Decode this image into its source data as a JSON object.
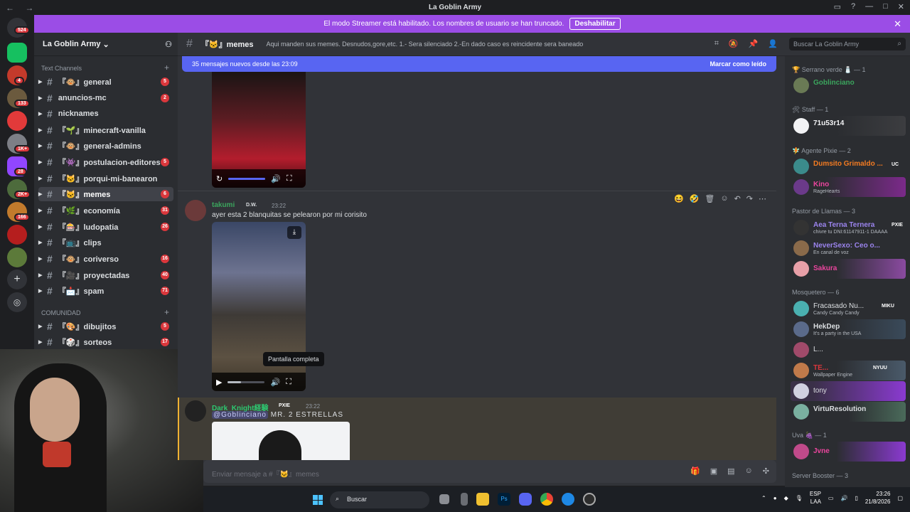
{
  "window": {
    "title": "La Goblin Army",
    "nav": "← →"
  },
  "banner": {
    "text": "El modo Streamer está habilitado. Los nombres de usuario se han truncado.",
    "button": "Deshabilitar"
  },
  "guild_badges": [
    "524",
    "4",
    "133",
    "1K+",
    "28",
    "2K+",
    "166"
  ],
  "server": {
    "name": "La Goblin Army",
    "categories": {
      "text_channels": "Text Channels",
      "comunidad": "COMUNIDAD"
    },
    "channels": [
      {
        "label": "『🐵』general",
        "badge": "5"
      },
      {
        "label": "anuncios-mc",
        "badge": "2"
      },
      {
        "label": "nicknames",
        "badge": ""
      },
      {
        "label": "『🌱』minecraft-vanilla",
        "badge": ""
      },
      {
        "label": "『🐵』general-admins",
        "badge": ""
      },
      {
        "label": "『👾』postulacion-editores",
        "badge": "5"
      },
      {
        "label": "『🐱』porqui-mi-banearon",
        "badge": ""
      },
      {
        "label": "『🐱』memes",
        "badge": "6"
      },
      {
        "label": "『🌿』economía",
        "badge": "31"
      },
      {
        "label": "『🎰』ludopatia",
        "badge": "26"
      },
      {
        "label": "『📺』clips",
        "badge": ""
      },
      {
        "label": "『🐵』coriverso",
        "badge": "16"
      },
      {
        "label": "『🎥』proyectadas",
        "badge": "40"
      },
      {
        "label": "『📩』spam",
        "badge": "71"
      },
      {
        "label": "『🎨』dibujitos",
        "badge": "5"
      },
      {
        "label": "『🎲』sorteos",
        "badge": "17"
      }
    ]
  },
  "channel_header": {
    "name": "『🐱』memes",
    "topic": "Aqui manden sus memes. Desnudos,gore,etc. 1.- Sera silenciado 2.-En dado caso es reincidente sera baneado"
  },
  "search": {
    "placeholder": "Buscar La Goblin Army"
  },
  "new_messages": {
    "text": "35 mensajes nuevos desde las 23:09",
    "mark_read": "Marcar como leído"
  },
  "messages": [
    {
      "author": "takumi",
      "author_color": "#3ba55d",
      "tag": "D.W.",
      "time": "23:22",
      "text": "ayer esta 2 blanquitas se pelearon por mi corisito",
      "tooltip": "Pantalla completa"
    },
    {
      "author": "Dark_Knight経験",
      "author_color": "#2dc770",
      "tag": "PXIE",
      "time": "23:22",
      "mention": "@Goblinciano",
      "text": "MR. 2 ESTRELLAS"
    }
  ],
  "composer": {
    "placeholder": "Enviar mensaje a #『🐱』memes"
  },
  "members": {
    "groups": [
      {
        "label": "🏆 Serrano verde 🧂 — 1",
        "members": [
          {
            "name": "Goblinciano",
            "color": "#3ba55d",
            "status": ""
          }
        ]
      },
      {
        "label": "🛠 Staff — 1",
        "members": [
          {
            "name": "71u53r14",
            "color": "#f2f3f5",
            "status": ""
          }
        ]
      },
      {
        "label": "🧚 Agente Pixie — 2",
        "members": [
          {
            "name": "Dumsito Grimaldo ...",
            "color": "#f47b21",
            "status": "UC"
          },
          {
            "name": "Kino",
            "color": "#eb459e",
            "status": "RageHearts"
          }
        ]
      },
      {
        "label": "Pastor de Llamas — 3",
        "members": [
          {
            "name": "Aea Terna Ternera",
            "color": "#9b84ee",
            "status": "chivre tu DNI:61147911-1 DAAAA"
          },
          {
            "name": "NeverSexo: Ceo o...",
            "color": "#9b84ee",
            "status": "En canal de voz"
          },
          {
            "name": "Sakura",
            "color": "#eb459e",
            "status": ""
          }
        ]
      },
      {
        "label": "Mosquetero — 6",
        "members": [
          {
            "name": "Fracasado Nu...",
            "color": "#dbdee1",
            "status": "Candy Candy Candy"
          },
          {
            "name": "HekDep",
            "color": "#dbdee1",
            "status": "It's a party in the USA"
          },
          {
            "name": "L...",
            "color": "#dbdee1",
            "status": ""
          },
          {
            "name": "TE...",
            "color": "#da373c",
            "status": "Wallpaper Engine"
          },
          {
            "name": "tony",
            "color": "#dbdee1",
            "status": ""
          },
          {
            "name": "VirtuResolution",
            "color": "#dbdee1",
            "status": ""
          }
        ]
      },
      {
        "label": "Uva 🍇 — 1",
        "members": [
          {
            "name": "Jvne",
            "color": "#eb459e",
            "status": ""
          }
        ]
      },
      {
        "label": "Server Booster — 3",
        "members": []
      }
    ],
    "tags": {
      "aea": "PXIE",
      "fracasado": "MIKU",
      "te": "NYUU"
    }
  },
  "taskbar": {
    "search": "Buscar",
    "lang_top": "ESP",
    "lang_bottom": "LAA",
    "time": "23:26",
    "date": "21/8/2026"
  },
  "colors": {
    "accent": "#5865f2",
    "banner": "#9b4de6",
    "badge": "#da373c"
  }
}
